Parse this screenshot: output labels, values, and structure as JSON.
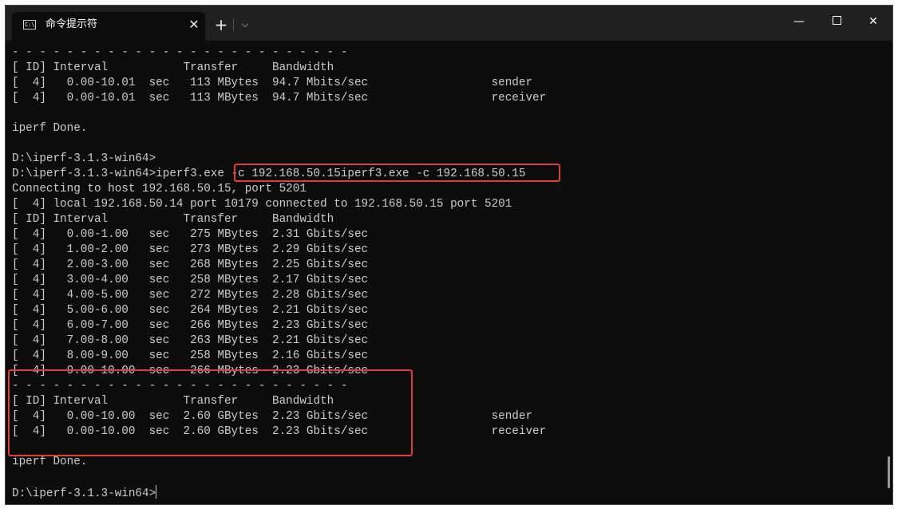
{
  "window": {
    "tab_title": "命令提示符",
    "tab_icon_text": "C:\\",
    "tab_close_glyph": "✕",
    "new_tab_glyph": "+",
    "dropdown_glyph": "⌵",
    "minimize_glyph": "—",
    "close_glyph": "✕"
  },
  "terminal": {
    "lines": [
      "- - - - - - - - - - - - - - - - - - - - - - - - -",
      "[ ID] Interval           Transfer     Bandwidth",
      "[  4]   0.00-10.01  sec   113 MBytes  94.7 Mbits/sec                  sender",
      "[  4]   0.00-10.01  sec   113 MBytes  94.7 Mbits/sec                  receiver",
      "",
      "iperf Done.",
      "",
      "D:\\iperf-3.1.3-win64>",
      "D:\\iperf-3.1.3-win64>iperf3.exe -c 192.168.50.15iperf3.exe -c 192.168.50.15",
      "Connecting to host 192.168.50.15, port 5201",
      "[  4] local 192.168.50.14 port 10179 connected to 192.168.50.15 port 5201",
      "[ ID] Interval           Transfer     Bandwidth",
      "[  4]   0.00-1.00   sec   275 MBytes  2.31 Gbits/sec",
      "[  4]   1.00-2.00   sec   273 MBytes  2.29 Gbits/sec",
      "[  4]   2.00-3.00   sec   268 MBytes  2.25 Gbits/sec",
      "[  4]   3.00-4.00   sec   258 MBytes  2.17 Gbits/sec",
      "[  4]   4.00-5.00   sec   272 MBytes  2.28 Gbits/sec",
      "[  4]   5.00-6.00   sec   264 MBytes  2.21 Gbits/sec",
      "[  4]   6.00-7.00   sec   266 MBytes  2.23 Gbits/sec",
      "[  4]   7.00-8.00   sec   263 MBytes  2.21 Gbits/sec",
      "[  4]   8.00-9.00   sec   258 MBytes  2.16 Gbits/sec",
      "[  4]   9.00-10.00  sec   266 MBytes  2.23 Gbits/sec",
      "- - - - - - - - - - - - - - - - - - - - - - - - -",
      "[ ID] Interval           Transfer     Bandwidth",
      "[  4]   0.00-10.00  sec  2.60 GBytes  2.23 Gbits/sec                  sender",
      "[  4]   0.00-10.00  sec  2.60 GBytes  2.23 Gbits/sec                  receiver",
      "",
      "iperf Done.",
      "",
      "D:\\iperf-3.1.3-win64>"
    ]
  },
  "colors": {
    "terminal_bg": "#0c0c0c",
    "terminal_fg": "#cccccc",
    "titlebar_bg": "#202020",
    "highlight": "#e23a3a"
  }
}
